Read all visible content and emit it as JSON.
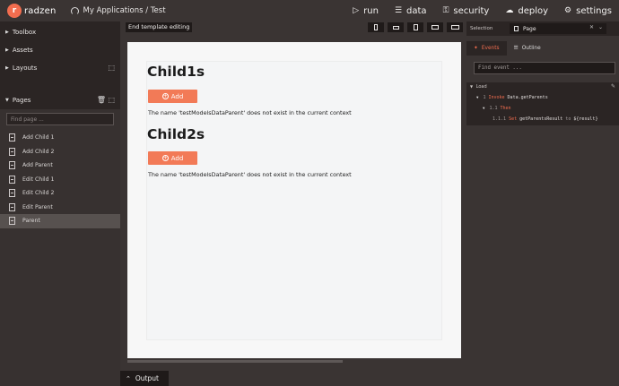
{
  "app": {
    "logo_text": "radzen",
    "logo_letter": "r",
    "breadcrumb": "My Applications / Test"
  },
  "topnav": [
    {
      "label": "run",
      "icon": "play-icon"
    },
    {
      "label": "data",
      "icon": "database-icon"
    },
    {
      "label": "security",
      "icon": "lock-icon"
    },
    {
      "label": "deploy",
      "icon": "cloud-upload-icon"
    },
    {
      "label": "settings",
      "icon": "gear-icon"
    }
  ],
  "left": {
    "sections": [
      "Toolbox",
      "Assets",
      "Layouts",
      "Pages"
    ],
    "find_placeholder": "Find page ...",
    "pages": [
      "Add Child 1",
      "Add Child 2",
      "Add Parent",
      "Edit Child 1",
      "Edit Child 2",
      "Edit Parent",
      "Parent"
    ],
    "active_page": "Parent"
  },
  "center": {
    "end_template_label": "End template editing",
    "devices": [
      "phone-portrait",
      "phone-landscape",
      "tablet-portrait",
      "tablet-landscape",
      "desktop"
    ]
  },
  "canvas": {
    "blocks": [
      {
        "heading": "Child1s",
        "button": "Add",
        "error": "The name 'testModelsDataParent' does not exist in the current context"
      },
      {
        "heading": "Child2s",
        "button": "Add",
        "error": "The name 'testModelsDataParent' does not exist in the current context"
      }
    ]
  },
  "output": {
    "label": "Output"
  },
  "right": {
    "selection_label": "Selection",
    "selection_value": "Page",
    "tabs": [
      "Events",
      "Outline"
    ],
    "active_tab": "Events",
    "find_event_placeholder": "Find event ...",
    "event_name": "Load",
    "line1_num": "1",
    "line1_kw": "Invoke",
    "line1_text": "Data.getParents",
    "line2_num": "1.1",
    "line2_kw": "Then",
    "line3_num": "1.1.1",
    "line3_kw": "Set",
    "line3_text": "getParentsResult",
    "line3_to": "to",
    "line3_val": "${result}"
  },
  "colors": {
    "accent": "#f26d4f",
    "topbar": "#3a3433",
    "panel_dark": "#2b2524",
    "canvas": "#f7f7f7",
    "button": "#f27a57"
  }
}
